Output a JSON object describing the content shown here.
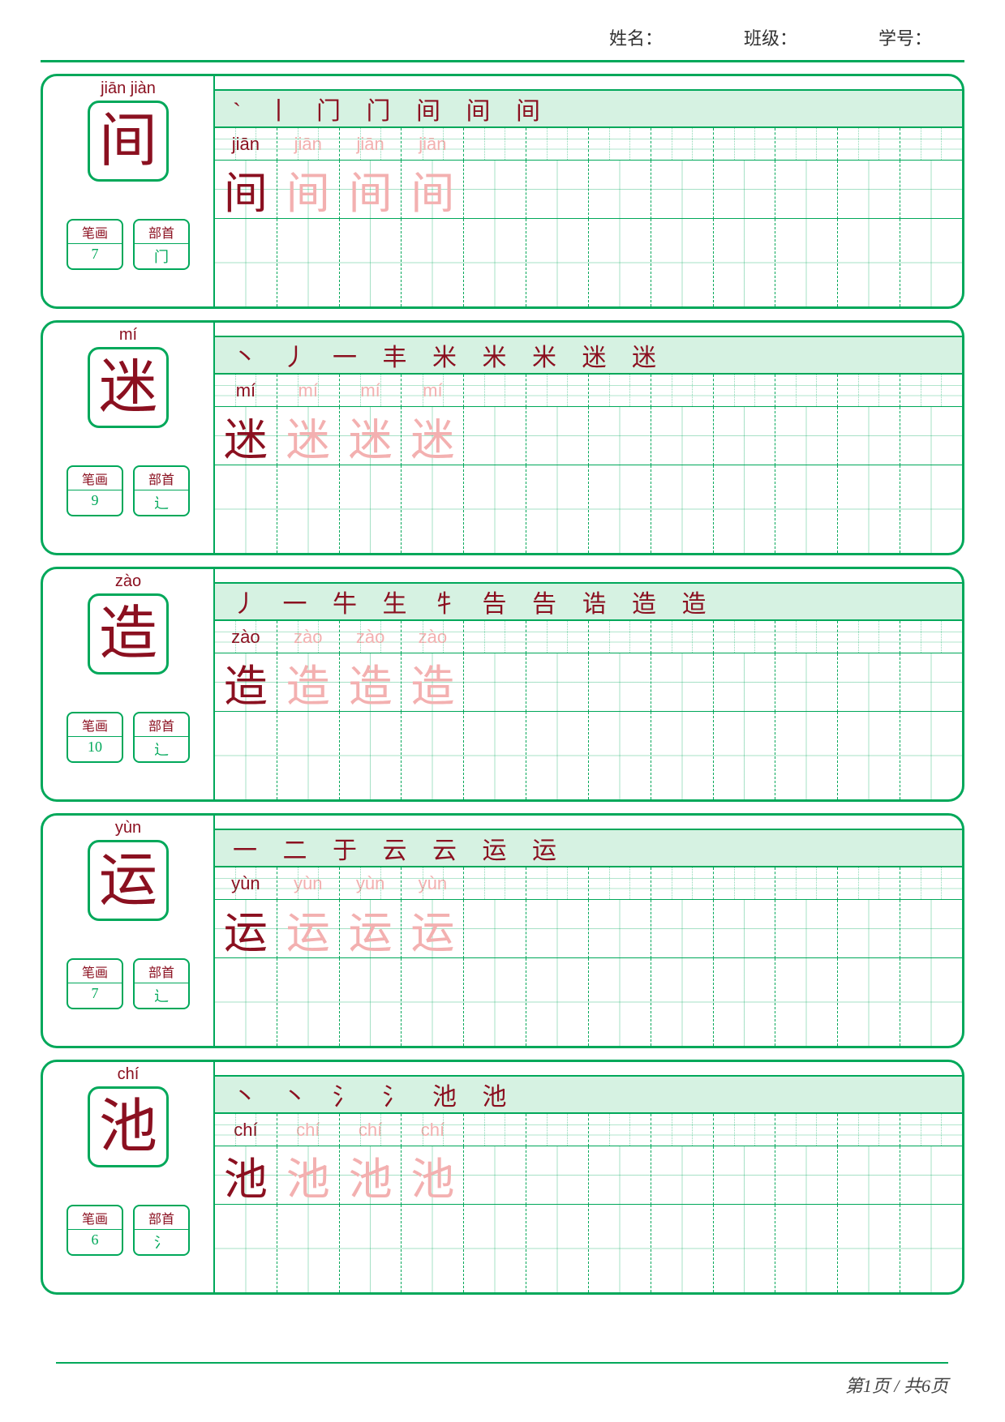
{
  "header": {
    "name_label": "姓名：",
    "class_label": "班级：",
    "id_label": "学号："
  },
  "meta_labels": {
    "strokes": "笔画",
    "radical": "部首"
  },
  "footer": {
    "page": "第1页",
    "sep": " / ",
    "total": "共6页"
  },
  "cols": 12,
  "entries": [
    {
      "pinyin_display": "jiān  jiàn",
      "char": "间",
      "strokes": "7",
      "radical": "门",
      "stroke_order": "` 丨 门 门 间 间 间",
      "pinyin_dark": "jiān",
      "pinyin_pale": [
        "jiān",
        "jiān",
        "jiān"
      ],
      "char_dark": "间",
      "char_pale": [
        "间",
        "间",
        "间"
      ]
    },
    {
      "pinyin_display": "mí",
      "char": "迷",
      "strokes": "9",
      "radical": "辶",
      "stroke_order": "丶 丿 一 丰 米 米 米 迷 迷",
      "pinyin_dark": "mí",
      "pinyin_pale": [
        "mí",
        "mí",
        "mí"
      ],
      "char_dark": "迷",
      "char_pale": [
        "迷",
        "迷",
        "迷"
      ]
    },
    {
      "pinyin_display": "zào",
      "char": "造",
      "strokes": "10",
      "radical": "辶",
      "stroke_order": "丿 一 牛 生 牜 告 告 诰 造 造",
      "pinyin_dark": "zào",
      "pinyin_pale": [
        "zào",
        "zào",
        "zào"
      ],
      "char_dark": "造",
      "char_pale": [
        "造",
        "造",
        "造"
      ]
    },
    {
      "pinyin_display": "yùn",
      "char": "运",
      "strokes": "7",
      "radical": "辶",
      "stroke_order": "一 二 于 云 云 运 运",
      "pinyin_dark": "yùn",
      "pinyin_pale": [
        "yùn",
        "yùn",
        "yùn"
      ],
      "char_dark": "运",
      "char_pale": [
        "运",
        "运",
        "运"
      ]
    },
    {
      "pinyin_display": "chí",
      "char": "池",
      "strokes": "6",
      "radical": "氵",
      "stroke_order": "丶 丶 氵 氵 池 池",
      "pinyin_dark": "chí",
      "pinyin_pale": [
        "chí",
        "chí",
        "chí"
      ],
      "char_dark": "池",
      "char_pale": [
        "池",
        "池",
        "池"
      ]
    }
  ]
}
